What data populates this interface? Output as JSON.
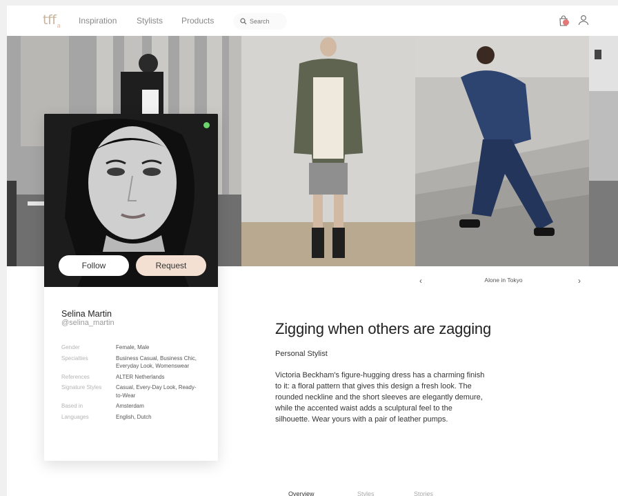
{
  "header": {
    "logo": "tff",
    "logo_suffix": "a",
    "nav": [
      "Inspiration",
      "Stylists",
      "Products"
    ],
    "search_placeholder": "Search"
  },
  "profile": {
    "name": "Selina Martin",
    "handle": "@selina_martin",
    "follow_label": "Follow",
    "request_label": "Request",
    "online_color": "#6ad36a",
    "details": [
      {
        "label": "Gender",
        "value": "Female, Male"
      },
      {
        "label": "Specialties",
        "value": "Business Casual, Business Chic, Everyday Look, Womenswear"
      },
      {
        "label": "References",
        "value": "ALTER Netherlands"
      },
      {
        "label": "Signature Styles",
        "value": "Casual, Every-Day Look, Ready-to-Wear"
      },
      {
        "label": "Based in",
        "value": "Amsterdam"
      },
      {
        "label": "Languages",
        "value": "English, Dutch"
      }
    ]
  },
  "carousel": {
    "caption": "Alone in Tokyo",
    "prev_icon": "chevron-left-icon",
    "next_icon": "chevron-right-icon"
  },
  "article": {
    "headline": "Zigging when others are zagging",
    "subtitle": "Personal Stylist",
    "body": "Victoria Beckham's figure-hugging dress has a charming finish to it: a floral pattern that gives this design a fresh look. The rounded neckline and the short sleeves are elegantly demure, while the accented waist adds a sculptural feel to the silhouette. Wear yours with a pair of leather pumps."
  },
  "tabs": [
    "Overview",
    "Styles",
    "Stories"
  ],
  "colors": {
    "accent": "#f3e0d2",
    "logo": "#c8b49c",
    "badge": "#e37878"
  }
}
